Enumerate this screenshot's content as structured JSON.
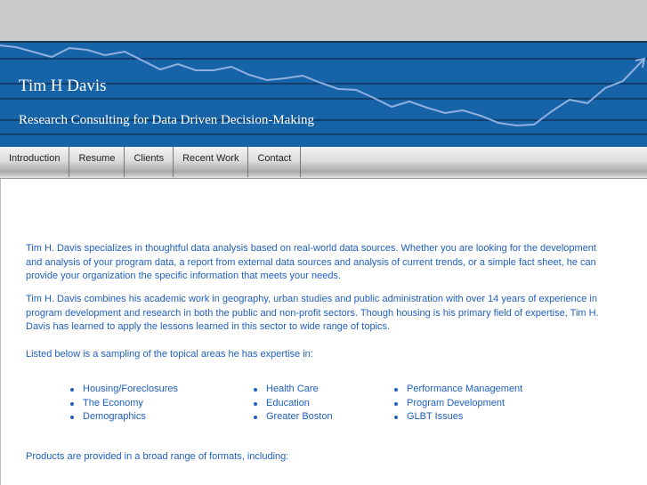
{
  "header": {
    "title": "Tim H Davis",
    "tagline": "Research Consulting for Data Driven Decision-Making"
  },
  "nav": [
    "Introduction",
    "Resume",
    "Clients",
    "Recent Work",
    "Contact"
  ],
  "content": {
    "paragraphs": [
      "Tim H. Davis specializes in thoughtful data analysis based on real-world data sources. Whether you are looking for the development and analysis of your program data, a report from external data sources and analysis of current trends, or a simple fact sheet, he can provide your organization the specific information that meets your needs.",
      "Tim H. Davis combines his academic work in geography, urban studies and public administration with over 14 years of experience in program development and research in both the public and non-profit sectors. Though housing is his primary field of expertise, Tim H. Davis has learned to apply the lessons learned in this sector to wide range of topics.",
      "Listed below is a sampling of the topical areas he has expertise in:",
      "Products are provided in a broad range of formats, including:"
    ],
    "topics": [
      [
        "Housing/Foreclosures",
        "The Economy",
        "Demographics"
      ],
      [
        "Health Care",
        "Education",
        "Greater Boston"
      ],
      [
        "Performance Management",
        "Program Development",
        "GLBT Issues"
      ]
    ]
  }
}
